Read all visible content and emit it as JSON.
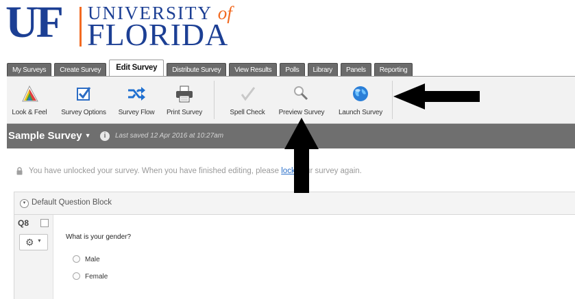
{
  "logo": {
    "uf": "UF",
    "university": "UNIVERSITY",
    "of": "of",
    "florida": "FLORIDA"
  },
  "tabs": [
    {
      "label": "My Surveys",
      "active": false
    },
    {
      "label": "Create Survey",
      "active": false
    },
    {
      "label": "Edit Survey",
      "active": true
    },
    {
      "label": "Distribute Survey",
      "active": false
    },
    {
      "label": "View Results",
      "active": false
    },
    {
      "label": "Polls",
      "active": false
    },
    {
      "label": "Library",
      "active": false
    },
    {
      "label": "Panels",
      "active": false
    },
    {
      "label": "Reporting",
      "active": false
    }
  ],
  "toolbar": {
    "look_feel": {
      "label": "Look & Feel",
      "icon": "look-feel-icon"
    },
    "survey_options": {
      "label": "Survey Options",
      "icon": "checkbox-icon"
    },
    "survey_flow": {
      "label": "Survey Flow",
      "icon": "flow-arrows-icon"
    },
    "print_survey": {
      "label": "Print Survey",
      "icon": "printer-icon"
    },
    "spell_check": {
      "label": "Spell Check",
      "icon": "checkmark-icon"
    },
    "preview_survey": {
      "label": "Preview Survey",
      "icon": "magnifier-icon"
    },
    "launch_survey": {
      "label": "Launch Survey",
      "icon": "globe-icon"
    }
  },
  "survey": {
    "title": "Sample Survey",
    "caret": "▼",
    "saved": "Last saved 12 Apr 2016 at 10:27am"
  },
  "notice": {
    "before": "You have unlocked your survey. When you have finished editing, please ",
    "link": "lock",
    "after": " your survey again."
  },
  "block": {
    "title": "Default Question Block",
    "collapse_glyph": "▼"
  },
  "question": {
    "number": "Q8",
    "text": "What is your gender?",
    "choices": [
      "Male",
      "Female"
    ]
  },
  "colors": {
    "uf_blue": "#1c3f94",
    "uf_orange": "#f26a21",
    "tab_bg": "#6b6b6b",
    "header_bg": "#6f6f6f",
    "link": "#2a6fc9"
  }
}
